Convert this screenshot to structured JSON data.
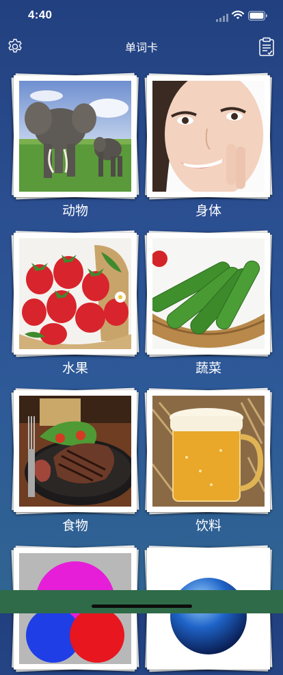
{
  "status_bar": {
    "time": "4:40",
    "icons": [
      "cellular-signal-icon",
      "wifi-icon",
      "battery-icon"
    ]
  },
  "nav": {
    "title": "单词卡",
    "left_icon": "gear-icon",
    "right_icon": "clipboard-icon"
  },
  "categories": [
    {
      "label": "动物",
      "image": "elephant-photo"
    },
    {
      "label": "身体",
      "image": "woman-face-photo"
    },
    {
      "label": "水果",
      "image": "strawberries-photo"
    },
    {
      "label": "蔬菜",
      "image": "cucumbers-photo"
    },
    {
      "label": "食物",
      "image": "steak-photo"
    },
    {
      "label": "饮料",
      "image": "beer-mug-photo"
    },
    {
      "label": "",
      "image": "color-circles-photo"
    },
    {
      "label": "",
      "image": "blue-sphere-photo"
    }
  ],
  "colors": {
    "background_top": "#22407f",
    "background_bottom": "#306591",
    "bottom_bar": "#2f6b49",
    "text": "#ffffff"
  }
}
